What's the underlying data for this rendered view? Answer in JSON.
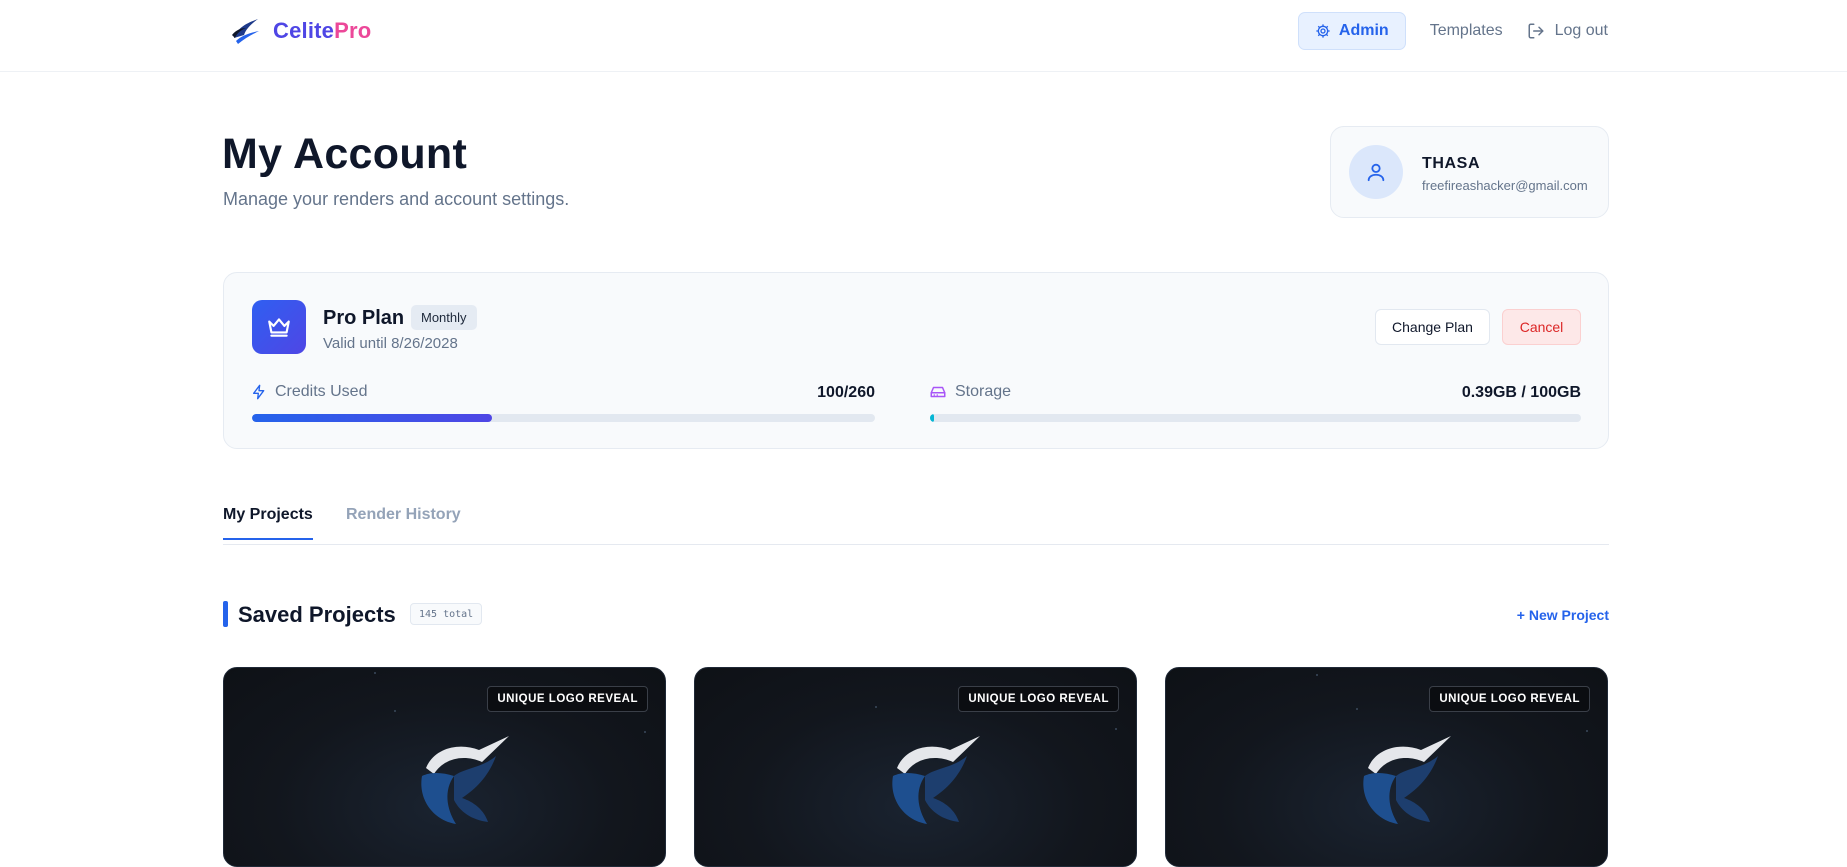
{
  "brand": {
    "name_part1": "Celite",
    "name_part2": "Pro"
  },
  "nav": {
    "admin": "Admin",
    "templates": "Templates",
    "logout": "Log out"
  },
  "page": {
    "title": "My Account",
    "subtitle": "Manage your renders and account settings."
  },
  "user": {
    "name": "THASA",
    "email": "freefireashacker@gmail.com"
  },
  "plan": {
    "name": "Pro Plan",
    "billing": "Monthly",
    "valid": "Valid until 8/26/2028",
    "change_label": "Change Plan",
    "cancel_label": "Cancel",
    "credits": {
      "label": "Credits Used",
      "value": "100/260",
      "fraction": 0.3846
    },
    "storage": {
      "label": "Storage",
      "value": "0.39GB / 100GB",
      "fraction": 0.0039
    }
  },
  "tabs": [
    {
      "label": "My Projects",
      "active": true
    },
    {
      "label": "Render History",
      "active": false
    }
  ],
  "projects": {
    "title": "Saved Projects",
    "count": "145 total",
    "new_label": "+ New Project",
    "items": [
      {
        "badge": "UNIQUE LOGO REVEAL"
      },
      {
        "badge": "UNIQUE LOGO REVEAL"
      },
      {
        "badge": "UNIQUE LOGO REVEAL"
      }
    ]
  },
  "icons": {
    "brand": "brand-logo-icon",
    "admin": "gear-icon",
    "logout": "logout-icon",
    "user": "user-icon",
    "plan": "crown-icon",
    "credits": "lightning-icon",
    "storage": "hard-drive-icon"
  },
  "colors": {
    "accent": "#2563eb",
    "brand_primary": "#4f46e5",
    "brand_secondary": "#ec4899",
    "danger": "#dc2626",
    "storage": "#a855f7"
  }
}
